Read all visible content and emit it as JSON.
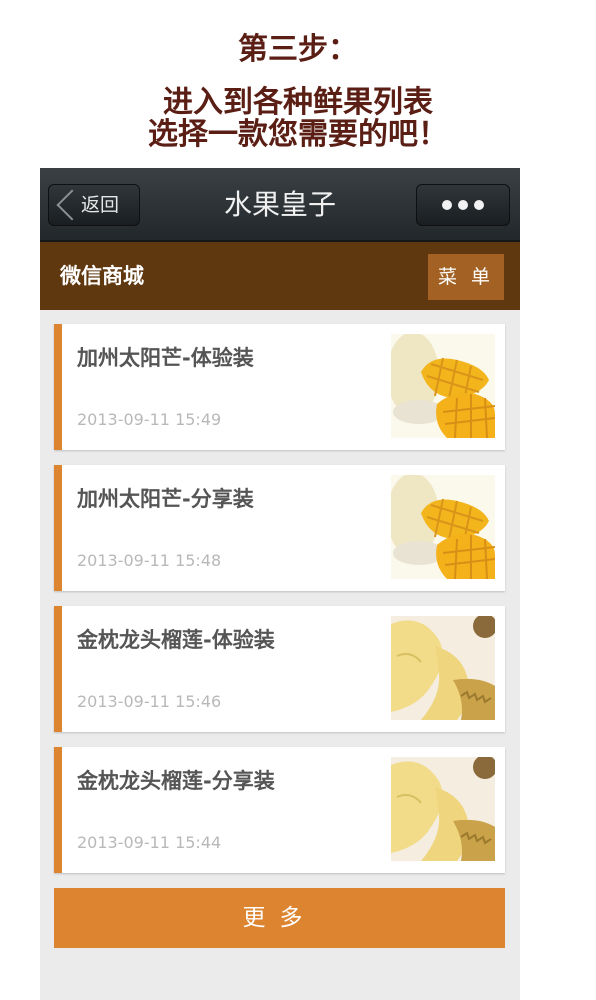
{
  "instructions": {
    "step": "第三步：",
    "line1": "进入到各种鲜果列表",
    "line2": "选择一款您需要的吧！"
  },
  "titlebar": {
    "back_label": "返回",
    "title": "水果皇子",
    "more_icon": "more-dots-icon"
  },
  "shopbar": {
    "name": "微信商城",
    "menu_label": "菜 单"
  },
  "colors": {
    "accent": "#dc8430",
    "shopbar": "#60380f",
    "titlebar": "#2b3033",
    "heading": "#5a1e14"
  },
  "products": [
    {
      "title": "加州太阳芒-体验装",
      "date": "2013-09-11 15:49",
      "image": "mango-image"
    },
    {
      "title": "加州太阳芒-分享装",
      "date": "2013-09-11 15:48",
      "image": "mango-image"
    },
    {
      "title": "金枕龙头榴莲-体验装",
      "date": "2013-09-11 15:46",
      "image": "durian-image"
    },
    {
      "title": "金枕龙头榴莲-分享装",
      "date": "2013-09-11 15:44",
      "image": "durian-image"
    }
  ],
  "more_label": "更多"
}
